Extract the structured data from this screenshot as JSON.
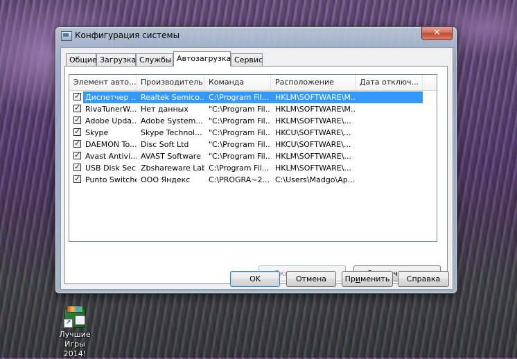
{
  "window": {
    "title": "Конфигурация системы",
    "close_glyph": "✕"
  },
  "tabs": [
    {
      "label": "Общие"
    },
    {
      "label": "Загрузка"
    },
    {
      "label": "Службы"
    },
    {
      "label": "Автозагрузка",
      "active": true
    },
    {
      "label": "Сервис"
    }
  ],
  "startup_list": {
    "columns": [
      "Элемент авто...",
      "Производитель",
      "Команда",
      "Расположение",
      "Дата отключ..."
    ],
    "rows": [
      {
        "checked": true,
        "item": "Диспетчер ...",
        "vendor": "Realtek Semico...",
        "command": "C:\\Program Fil...",
        "location": "HKLM\\SOFTWARE\\M...",
        "date": "",
        "selected": true
      },
      {
        "checked": true,
        "item": "RivaTunerW...",
        "vendor": "Нет данных",
        "command": "\"C:\\Program Fil...",
        "location": "HKLM\\SOFTWARE\\M...",
        "date": ""
      },
      {
        "checked": true,
        "item": "Adobe Upda...",
        "vendor": "Adobe System...",
        "command": "\"C:\\Program Fil...",
        "location": "HKLM\\SOFTWARE\\...",
        "date": ""
      },
      {
        "checked": true,
        "item": "Skype",
        "vendor": "Skype Technol...",
        "command": "\"C:\\Program Fil...",
        "location": "HKCU\\SOFTWARE\\...",
        "date": ""
      },
      {
        "checked": true,
        "item": "DAEMON To...",
        "vendor": "Disc Soft Ltd",
        "command": "\"C:\\Program Fil...",
        "location": "HKCU\\SOFTWARE\\...",
        "date": ""
      },
      {
        "checked": true,
        "item": "Avast Antivi...",
        "vendor": "AVAST Software",
        "command": "\"C:\\Program Fil...",
        "location": "HKLM\\SOFTWARE\\...",
        "date": ""
      },
      {
        "checked": true,
        "item": "USB Disk Sec...",
        "vendor": "Zbshareware Lab",
        "command": "C:\\Program Fil...",
        "location": "HKLM\\SOFTWARE\\...",
        "date": ""
      },
      {
        "checked": true,
        "item": "Punto Switcher",
        "vendor": "ООО Яндекс",
        "command": "C:\\PROGRA~2...",
        "location": "C:\\Users\\Madgo\\Ap...",
        "date": ""
      }
    ]
  },
  "panel_buttons": {
    "enable_all_pre": "Включить ",
    "enable_all_acc": "в",
    "enable_all_post": "се",
    "disable_all_pre": "Отключить ",
    "disable_all_acc": "в",
    "disable_all_post": "се"
  },
  "dialog_buttons": {
    "ok": "OK",
    "cancel": "Отмена",
    "apply_pre": "Пр",
    "apply_acc": "и",
    "apply_post": "менить",
    "help": "Справка"
  },
  "desktop": {
    "icon_label_line1": "Лучшие",
    "icon_label_line2": "Игры 2014!"
  }
}
